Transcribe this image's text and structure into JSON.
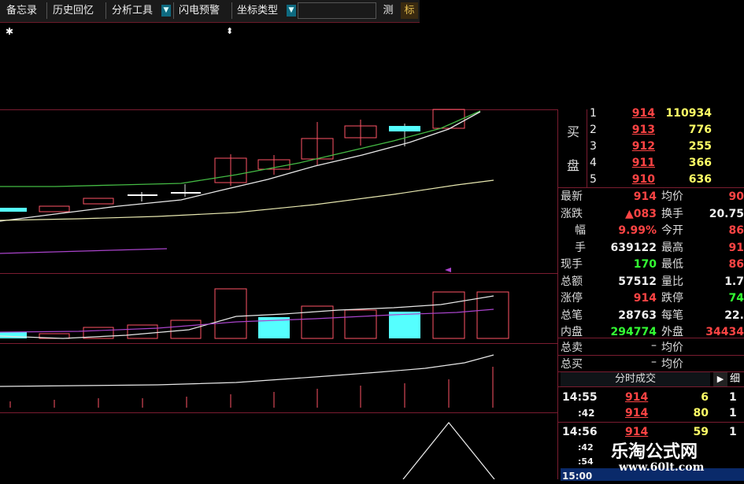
{
  "toolbar": {
    "memo": "备忘录",
    "history": "历史回忆",
    "analysis": "分析工具",
    "alert": "闪电预警",
    "coord": "坐标类型",
    "measure": "测",
    "mark": "标",
    "dropdown_glyph": "▼"
  },
  "chart_markers": {
    "star": "✱",
    "updown": "⬍"
  },
  "order_book": {
    "buy_label_1": "买",
    "buy_label_2": "盘",
    "rows": [
      {
        "level": "1",
        "price": "914",
        "volume": "110934"
      },
      {
        "level": "2",
        "price": "913",
        "volume": "776"
      },
      {
        "level": "3",
        "price": "912",
        "volume": "255"
      },
      {
        "level": "4",
        "price": "911",
        "volume": "366"
      },
      {
        "level": "5",
        "price": "910",
        "volume": "636"
      }
    ]
  },
  "quote": {
    "latest_label": "最新",
    "latest": "914",
    "avg_label": "均价",
    "avg": "90",
    "change_label": "涨跌",
    "change": "▲083",
    "turnover_label": "换手",
    "turnover": "20.75",
    "pct_label": "幅",
    "pct": "9.99%",
    "open_label": "今开",
    "open": "86",
    "hands_label": "手",
    "hands": "639122",
    "high_label": "最高",
    "high": "91",
    "cur_label": "现手",
    "cur": "170",
    "low_label": "最低",
    "low": "86",
    "amount_label": "总额",
    "amount": "57512",
    "ratio_label": "量比",
    "ratio": "1.7",
    "limitup_label": "涨停",
    "limitup": "914",
    "limitdown_label": "跌停",
    "limitdown": "74",
    "trades_label": "总笔",
    "trades": "28763",
    "per_trade_label": "每笔",
    "per_trade": "22.",
    "inner_label": "内盘",
    "inner": "294774",
    "outer_label": "外盘",
    "outer": "34434",
    "total_sell_label": "总卖",
    "total_sell": "–",
    "total_sell_avg_label": "均价",
    "total_buy_label": "总买",
    "total_buy": "–",
    "total_buy_avg_label": "均价"
  },
  "ticks": {
    "header": "分时成交",
    "play_glyph": "▶",
    "detail_label": "细",
    "rows": [
      {
        "time": "14:55",
        "price": "914",
        "vol": "6",
        "flag": "1"
      },
      {
        "time": ":42",
        "price": "914",
        "vol": "80",
        "flag": "1"
      },
      {
        "time": "14:56",
        "price": "914",
        "vol": "59",
        "flag": "1"
      },
      {
        "time": ":42",
        "price": "",
        "vol": "",
        "flag": ""
      },
      {
        "time": ":54",
        "price": "",
        "vol": "",
        "flag": ""
      },
      {
        "time": "15:00",
        "price": "",
        "vol": "",
        "flag": ""
      }
    ]
  },
  "watermark": {
    "title": "乐淘公式网",
    "url": "www.60lt.com"
  },
  "colors": {
    "up": "#ff4444",
    "down": "#55ffff",
    "grid": "#7a1c30",
    "ma_green": "#44bb44",
    "ma_white": "#e8e8e8",
    "ma_yellow": "#e8e8b0",
    "ma_purple": "#aa44cc"
  }
}
